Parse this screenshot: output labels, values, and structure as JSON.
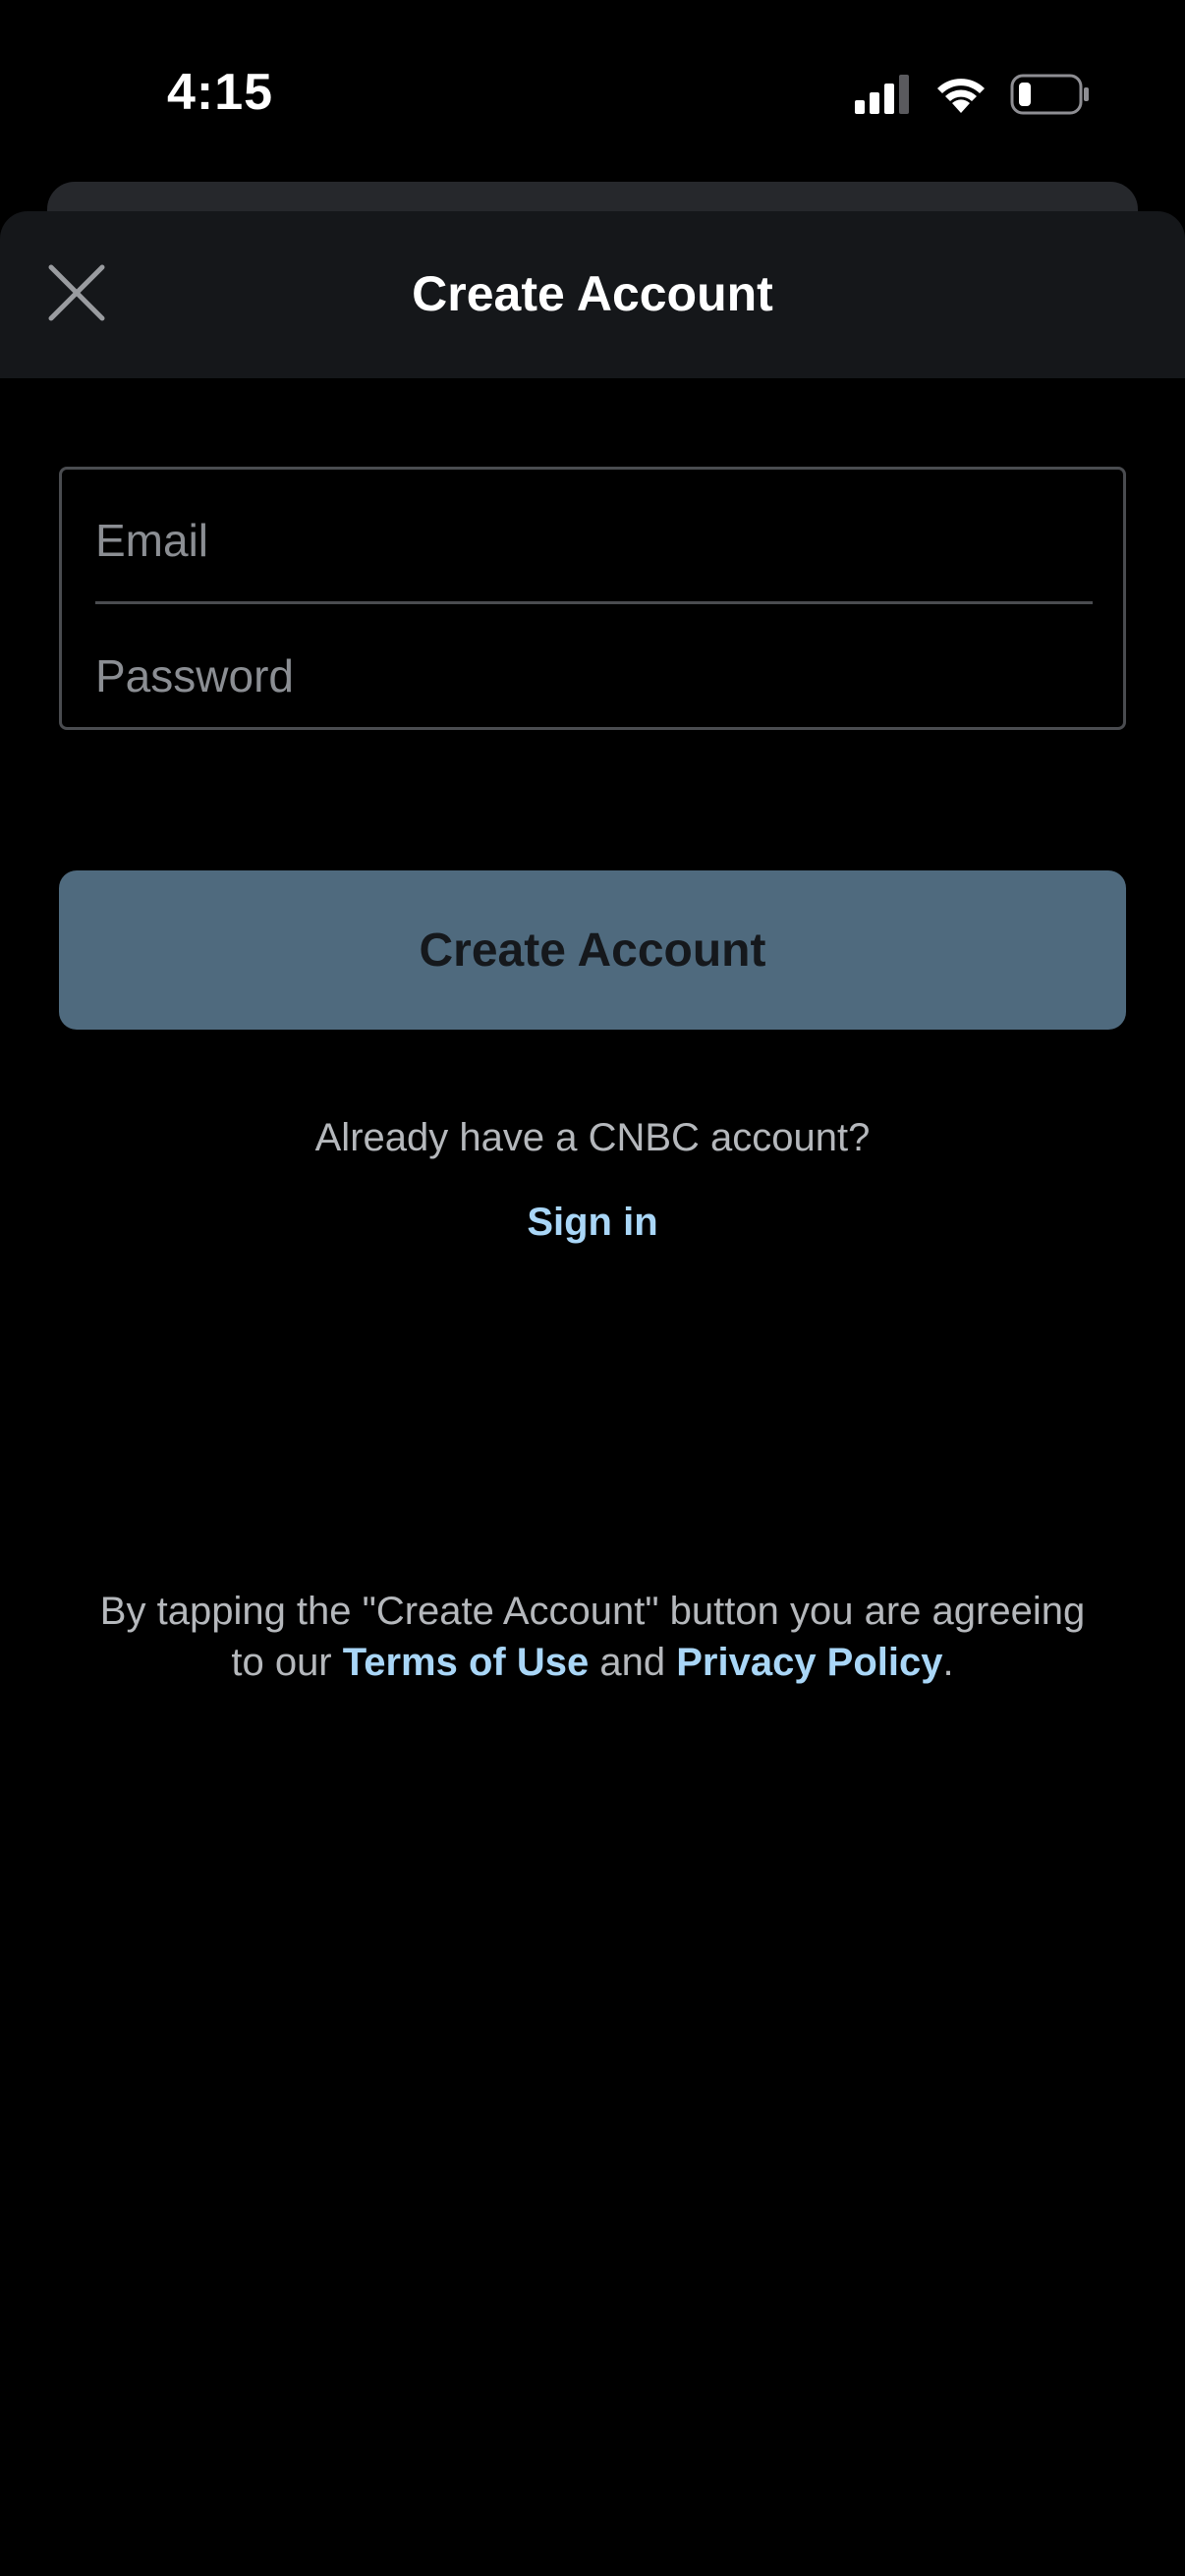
{
  "status_bar": {
    "time": "4:15",
    "icons": [
      "cellular-signal-icon",
      "wifi-icon",
      "battery-icon"
    ]
  },
  "header": {
    "title": "Create Account",
    "close_icon": "close-icon"
  },
  "form": {
    "email": {
      "value": "",
      "placeholder": "Email"
    },
    "password": {
      "value": "",
      "placeholder": "Password"
    },
    "submit_label": "Create Account"
  },
  "signin": {
    "prompt": "Already have a CNBC account?",
    "link_label": "Sign in"
  },
  "legal": {
    "line1": "By tapping the \"Create Account\" button you are agreeing",
    "line2_prefix": "to our",
    "terms_label": "Terms of Use",
    "and_text": "and",
    "privacy_label": "Privacy Policy",
    "suffix": "."
  },
  "colors": {
    "background": "#000000",
    "header_background": "#15171a",
    "button_background": "#4f6a7e",
    "link_color": "#a9d6f7",
    "muted_text": "#b5b8bc"
  }
}
